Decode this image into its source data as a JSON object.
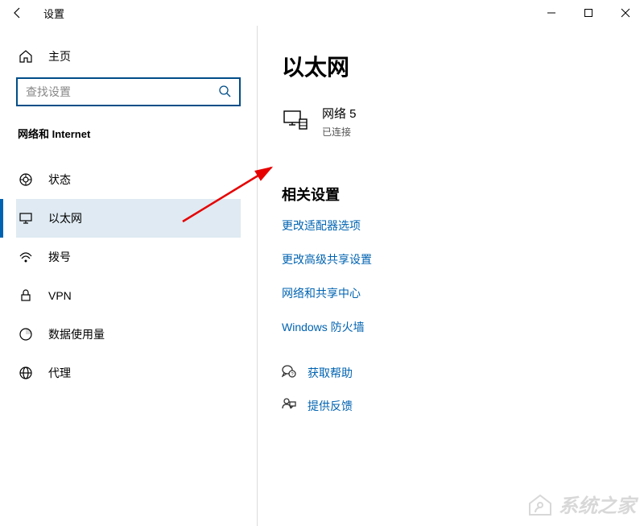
{
  "window": {
    "title": "设置"
  },
  "sidebar": {
    "home": "主页",
    "search_placeholder": "查找设置",
    "category": "网络和 Internet",
    "items": [
      {
        "label": "状态"
      },
      {
        "label": "以太网"
      },
      {
        "label": "拨号"
      },
      {
        "label": "VPN"
      },
      {
        "label": "数据使用量"
      },
      {
        "label": "代理"
      }
    ]
  },
  "main": {
    "title": "以太网",
    "network": {
      "name": "网络 5",
      "status": "已连接"
    },
    "related_title": "相关设置",
    "links": [
      "更改适配器选项",
      "更改高级共享设置",
      "网络和共享中心",
      "Windows 防火墙"
    ],
    "help": "获取帮助",
    "feedback": "提供反馈"
  },
  "watermark": "系统之家"
}
